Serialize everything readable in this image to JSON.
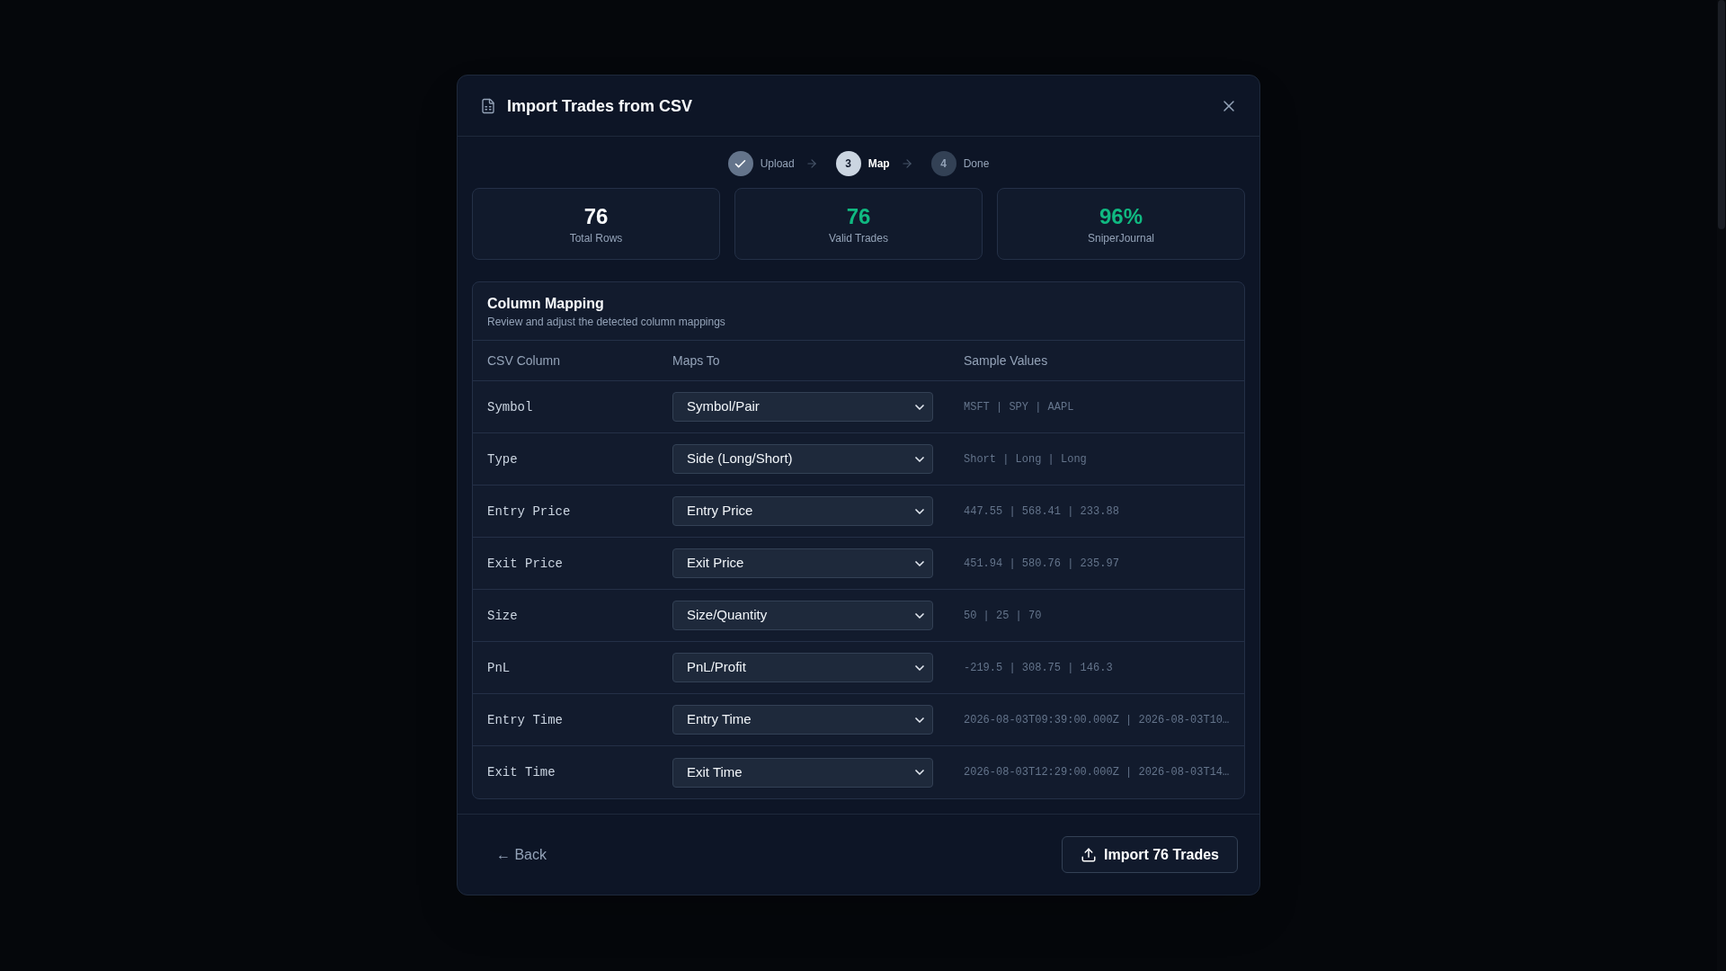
{
  "dialog": {
    "title": "Import Trades from CSV"
  },
  "steps": [
    {
      "label": "Upload",
      "completed": true,
      "current": false
    },
    {
      "number": "3",
      "label": "Map",
      "completed": false,
      "current": true
    },
    {
      "number": "4",
      "label": "Done",
      "completed": false,
      "current": false
    }
  ],
  "stats": [
    {
      "value": "76",
      "label": "Total Rows",
      "color": "#f8fafc"
    },
    {
      "value": "76",
      "label": "Valid Trades",
      "color": "#10b981"
    },
    {
      "value": "96%",
      "label": "SniperJournal",
      "color": "#10b981"
    }
  ],
  "mapping": {
    "title": "Column Mapping",
    "subtitle": "Review and adjust the detected column mappings",
    "columns": [
      "CSV Column",
      "Maps To",
      "Sample Values"
    ],
    "rows": [
      {
        "csv_column": "Symbol",
        "maps_to": "Symbol/Pair",
        "samples": "MSFT | SPY | AAPL"
      },
      {
        "csv_column": "Type",
        "maps_to": "Side (Long/Short)",
        "samples": "Short | Long | Long"
      },
      {
        "csv_column": "Entry Price",
        "maps_to": "Entry Price",
        "samples": "447.55 | 568.41 | 233.88"
      },
      {
        "csv_column": "Exit Price",
        "maps_to": "Exit Price",
        "samples": "451.94 | 580.76 | 235.97"
      },
      {
        "csv_column": "Size",
        "maps_to": "Size/Quantity",
        "samples": "50 | 25 | 70"
      },
      {
        "csv_column": "PnL",
        "maps_to": "PnL/Profit",
        "samples": "-219.5 | 308.75 | 146.3"
      },
      {
        "csv_column": "Entry Time",
        "maps_to": "Entry Time",
        "samples": "2026-08-03T09:39:00.000Z | 2026-08-03T10…"
      },
      {
        "csv_column": "Exit Time",
        "maps_to": "Exit Time",
        "samples": "2026-08-03T12:29:00.000Z | 2026-08-03T14…"
      }
    ]
  },
  "footer": {
    "back": "← Back",
    "import": "Import 76 Trades"
  }
}
